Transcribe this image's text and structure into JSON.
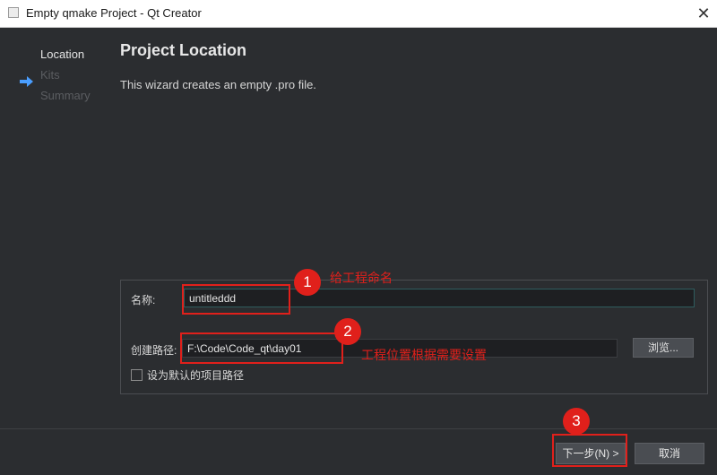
{
  "window": {
    "title": "Empty qmake Project - Qt Creator",
    "close_glyph": "✕"
  },
  "sidebar": {
    "steps": [
      {
        "label": "Location",
        "active": true
      },
      {
        "label": "Kits",
        "active": false
      },
      {
        "label": "Summary",
        "active": false
      }
    ],
    "current_indicator_icon": "arrow-right-icon"
  },
  "page": {
    "title": "Project Location",
    "description": "This wizard creates an empty .pro file."
  },
  "form": {
    "name_label": "名称:",
    "name_value": "untitleddd",
    "path_label": "创建路径:",
    "path_value": "F:\\Code\\Code_qt\\day01",
    "browse_label": "浏览...",
    "default_path_label": "设为默认的项目路径",
    "default_path_checked": false
  },
  "buttons": {
    "next": "下一步(N) >",
    "cancel": "取消"
  },
  "annotations": [
    {
      "number": "1",
      "text": "给工程命名"
    },
    {
      "number": "2",
      "text": "工程位置根据需要设置"
    },
    {
      "number": "3",
      "text": ""
    }
  ],
  "colors": {
    "annotation": "#e0201b",
    "background": "#2b2d30",
    "accent_arrow": "#4a9eff"
  }
}
